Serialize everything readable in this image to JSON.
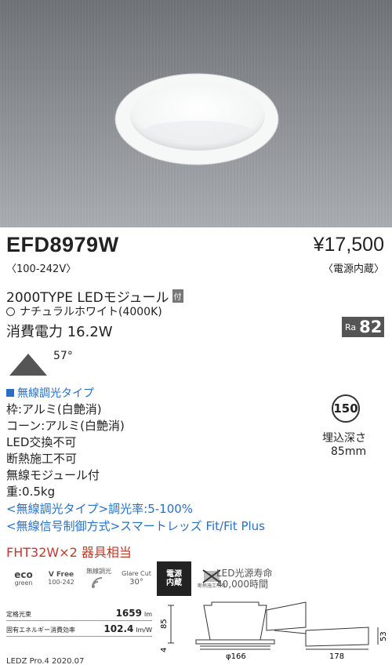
{
  "product": {
    "model": "EFD8979W",
    "price": "¥17,500",
    "voltage": "〈100-242V〉",
    "power_supply_note": "〈電源内蔵〉",
    "module": "2000TYPE LEDモジュール",
    "module_badge": "付",
    "light_color": "ナチュラルホワイト(4000K)",
    "power_consumption": "消費電力 16.2W",
    "ra_label": "Ra",
    "ra_value": "82",
    "beam_angle": "57°"
  },
  "specs": {
    "type_label": "無線調光タイプ",
    "lines": [
      "枠:アルミ(白艶消)",
      "コーン:アルミ(白艶消)",
      "LED交換不可",
      "断熱施工不可",
      "無線モジュール付",
      "重:0.5kg"
    ],
    "blue_lines": [
      "<無線調光タイプ>調光率:5-100%",
      "<無線信号制御方式>スマートレッズ Fit/Fit Plus"
    ],
    "equivalent": "FHT32W×2 器具相当"
  },
  "cutout": {
    "hole": "150",
    "depth_label": "埋込深さ",
    "depth_value": "85mm"
  },
  "icons": {
    "eco_top": "eco",
    "eco_bottom": "green",
    "vfree_top": "V Free",
    "vfree_bottom": "100-242",
    "wireless": "無線調光",
    "glare_top": "Glare Cut",
    "glare_bottom": "30°",
    "builtin_power": "電源\n内蔵",
    "no_insulation": "断熱施工不可",
    "life_line1": "LED光源寿命",
    "life_line2": "40,000時間"
  },
  "performance": {
    "flux_label": "定格光束",
    "flux_value": "1659",
    "flux_unit": "lm",
    "eff_label": "固有エネルギー消費効率",
    "eff_value": "102.4",
    "eff_unit": "lm/W"
  },
  "dimensions": {
    "height": "85",
    "flange": "4",
    "diameter": "φ166",
    "length": "178",
    "height2": "53"
  },
  "footer": "LEDZ Pro.4 2020.07"
}
